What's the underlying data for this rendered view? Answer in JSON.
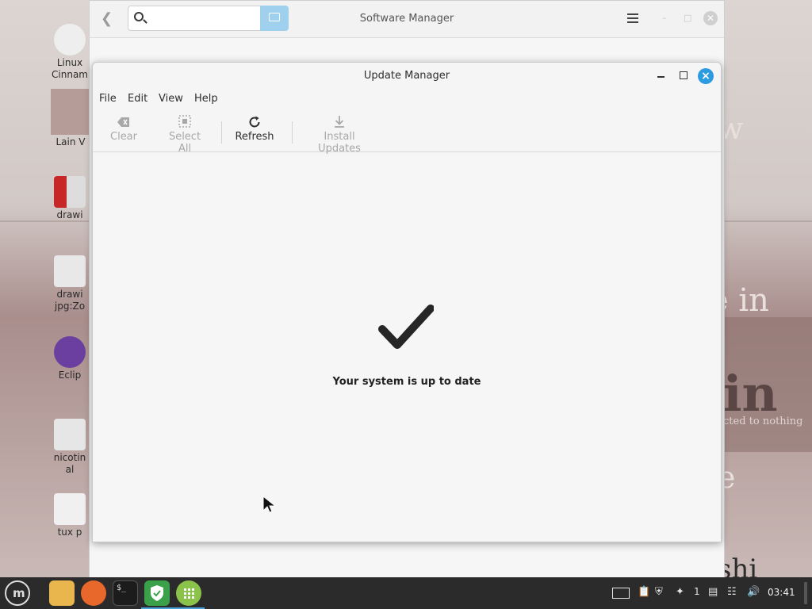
{
  "software_manager": {
    "title": "Software Manager",
    "search_placeholder": ""
  },
  "update_manager": {
    "title": "Update Manager",
    "menu": [
      "File",
      "Edit",
      "View",
      "Help"
    ],
    "toolbar": {
      "clear": "Clear",
      "select_all": "Select All",
      "refresh": "Refresh",
      "install_updates": "Install Updates"
    },
    "status_text": "Your system is up to date"
  },
  "desktop": {
    "icons": [
      {
        "label": "Linux Cinnam"
      },
      {
        "label": "Lain V"
      },
      {
        "label": "drawi"
      },
      {
        "label": "drawi jpg:Zo"
      },
      {
        "label": "Eclip"
      },
      {
        "label": "nicotin al"
      },
      {
        "label": "tux p"
      }
    ],
    "wallpaper_text": [
      "w",
      "e in",
      "in",
      "cted to nothing",
      "e",
      "shi"
    ]
  },
  "taskbar": {
    "clock": "03:41",
    "tray_count": "1",
    "colors": {
      "accent": "#49a3d8",
      "mint": "#8bc34a",
      "shield": "#4caf50"
    }
  }
}
